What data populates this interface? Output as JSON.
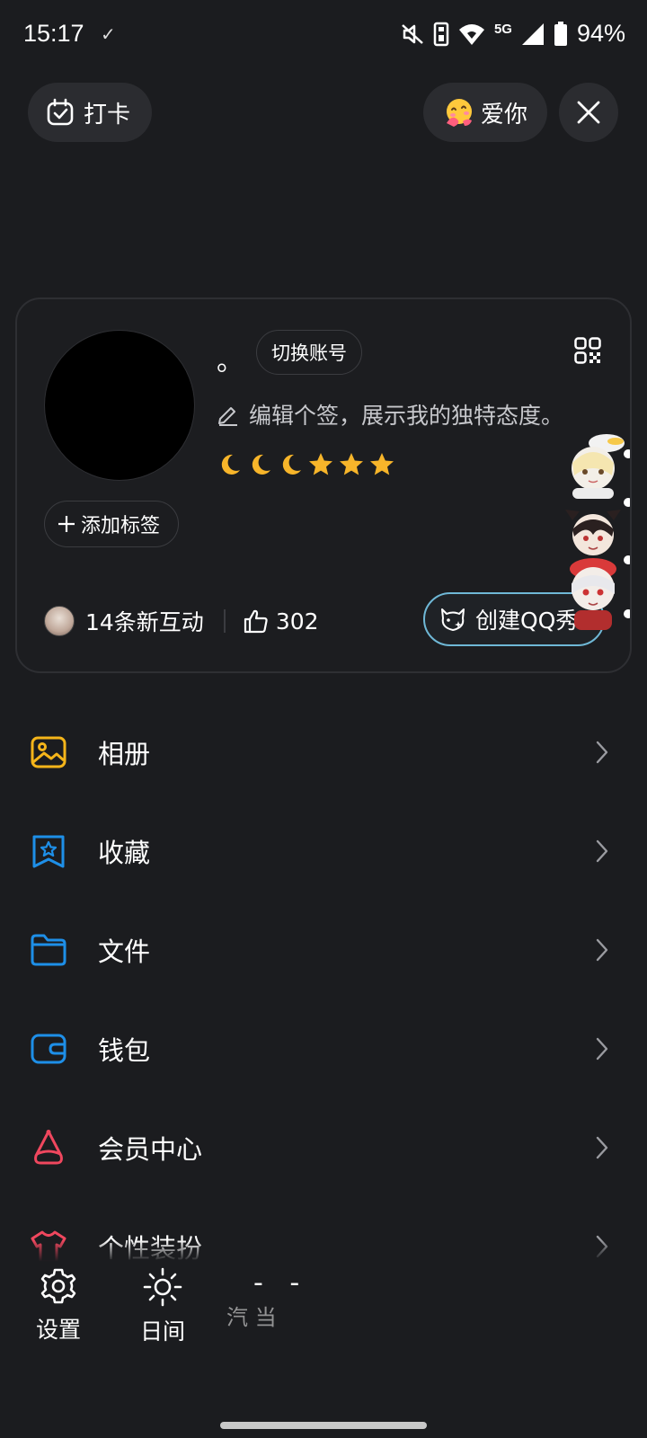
{
  "status_bar": {
    "time": "15:17",
    "network": "5G",
    "battery": "94%"
  },
  "top": {
    "checkin_label": "打卡",
    "love_label": "爱你"
  },
  "profile": {
    "nickname": "。",
    "switch_account": "切换账号",
    "signature": "编辑个签，展示我的独特态度。",
    "level_icons": [
      "moon",
      "moon",
      "moon",
      "star",
      "star",
      "star"
    ],
    "add_tag": "添加标签",
    "interactions": "14条新互动",
    "likes": "302",
    "create_show": "创建QQ秀"
  },
  "menu": {
    "items": [
      {
        "label": "相册",
        "icon": "album-icon",
        "color": "#f5b51a"
      },
      {
        "label": "收藏",
        "icon": "favorites-icon",
        "color": "#1e8fe8"
      },
      {
        "label": "文件",
        "icon": "folder-icon",
        "color": "#1e8fe8"
      },
      {
        "label": "钱包",
        "icon": "wallet-icon",
        "color": "#1e8fe8"
      },
      {
        "label": "会员中心",
        "icon": "vip-icon",
        "color": "#f0475e"
      },
      {
        "label": "个性装扮",
        "icon": "outfit-icon",
        "color": "#f0475e"
      }
    ]
  },
  "bottom": {
    "settings": "设置",
    "day_mode": "日间",
    "weather_value": "- -",
    "weather_text": "汽 当"
  },
  "colors": {
    "background": "#1b1c1f",
    "pill": "#2b2c30",
    "accent_yellow": "#f5b51a",
    "accent_blue": "#1e8fe8",
    "accent_red": "#f0475e",
    "qq_show_border": "#6fb8d6"
  }
}
